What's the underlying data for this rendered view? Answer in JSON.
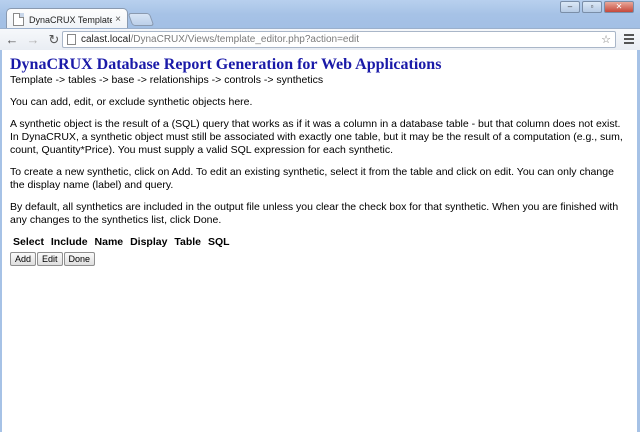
{
  "browser": {
    "tab_title": "DynaCRUX Template Edito",
    "tab_close": "×",
    "url_host": "calast.local",
    "url_path": "/DynaCRUX/Views/template_editor.php?action=edit",
    "back_glyph": "←",
    "forward_glyph": "→",
    "reload_glyph": "↻",
    "star_glyph": "☆",
    "minimize_glyph": "–",
    "maximize_glyph": "▫",
    "close_glyph": "✕",
    "icons": {
      "back": "back-arrow-icon",
      "forward": "forward-arrow-icon",
      "reload": "reload-icon",
      "bookmark": "star-icon",
      "menu": "hamburger-menu-icon"
    }
  },
  "page": {
    "title": "DynaCRUX Database Report Generation for Web Applications",
    "breadcrumb": "Template -> tables -> base -> relationships -> controls -> synthetics",
    "paragraphs": [
      "You can add, edit, or exclude synthetic objects here.",
      "A synthetic object is the result of a (SQL) query that works as if it was a column in a database table - but that column does not exist. In DynaCRUX, a synthetic object must still be associated with exactly one table, but it may be the result of a computation (e.g., sum, count, Quantity*Price). You must supply a valid SQL expression for each synthetic.",
      "To create a new synthetic, click on Add. To edit an existing synthetic, select it from the table and click on edit. You can only change the display name (label) and query.",
      "By default, all synthetics are included in the output file unless you clear the check box for that synthetic. When you are finished with any changes to the synthetics list, click Done."
    ],
    "table_headers": [
      "Select",
      "Include",
      "Name",
      "Display",
      "Table",
      "SQL"
    ],
    "buttons": {
      "add": "Add",
      "edit": "Edit",
      "done": "Done"
    }
  },
  "colors": {
    "title": "#1a1aa8",
    "chrome": "#a6c2e6"
  }
}
